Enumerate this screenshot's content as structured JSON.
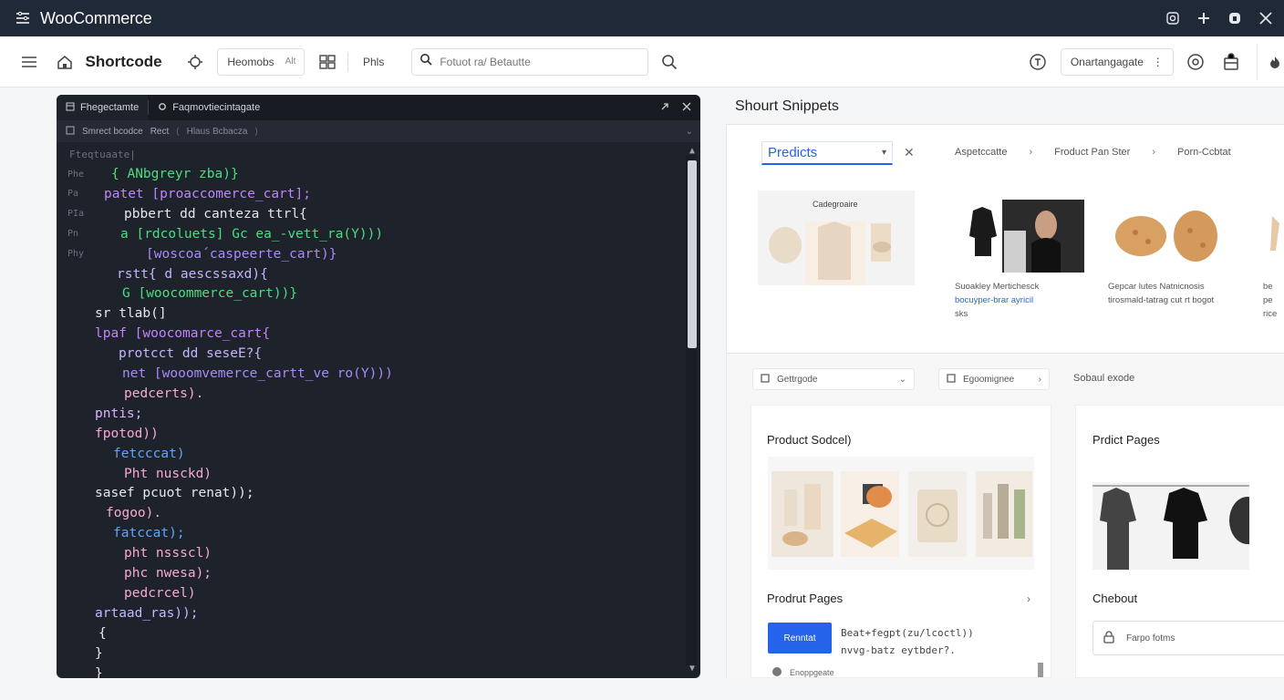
{
  "window": {
    "title": "WooCommerce",
    "controls": [
      "camera-icon",
      "plus-icon",
      "lock-icon",
      "close-icon"
    ]
  },
  "toolbar": {
    "title": "Shortcode",
    "pill1": {
      "label": "Heomobs",
      "kbd": "Alt"
    },
    "pill2_label": "Phls",
    "search_placeholder": "Fotuot ra/ Betautte",
    "dropdown_label": "Onartangagate",
    "dropdown_kbd": "⋮"
  },
  "editor": {
    "tabs": [
      {
        "label": "Fhegectamte",
        "icon": "window-icon"
      },
      {
        "label": "Faqmovtiecintagate",
        "icon": "gear-icon"
      }
    ],
    "sub": [
      "Smrect bcodce",
      "Rect",
      "(",
      "Hlaus Bcbacza",
      ")"
    ],
    "first_comment": "Fteqtuaate|",
    "lines": [
      {
        "n": "Phe",
        "text": "{ ANbgreyr zba)}",
        "color": "#4ade80",
        "indent": 60
      },
      {
        "n": "Pa",
        "text": "patet [proaccomerce_cart];",
        "color": "#c084fc",
        "indent": 52
      },
      {
        "n": "PIa",
        "text": "pbbert dd canteza ttrl{",
        "color": "#e5e7eb",
        "indent": 74
      },
      {
        "n": "Pn",
        "text": "a [rdcoluets] Gc ea_-vett_ra(Y)))",
        "color": "#4ade80",
        "indent": 70
      },
      {
        "n": "Phy",
        "text": "[woscoa´caspeerte_cart)}",
        "color": "#a78bfa",
        "indent": 98
      },
      {
        "n": "",
        "text": "rstt{ d aescssaxd){",
        "color": "#c4b5fd",
        "indent": 66
      },
      {
        "n": "",
        "text": "G [woocommerce_cart))}",
        "color": "#4ade80",
        "indent": 72
      },
      {
        "n": "",
        "text": "sr tlab(]",
        "color": "#e5e7eb",
        "indent": 42
      },
      {
        "n": "",
        "text": "lpaf [woocomarce_cart{",
        "color": "#c084fc",
        "indent": 42
      },
      {
        "n": "",
        "text": "protcct dd seseE?{",
        "color": "#c4b5fd",
        "indent": 68
      },
      {
        "n": "",
        "text": "net [wooomvemerce_cartt_ve ro(Y)))",
        "color": "#a78bfa",
        "indent": 72
      },
      {
        "n": "",
        "text": "pedcerts).",
        "color": "#f9a8d4",
        "indent": 74
      },
      {
        "n": "",
        "text": "pntis;",
        "color": "#d8b4fe",
        "indent": 42
      },
      {
        "n": "",
        "text": "fpotod))",
        "color": "#f9a8d4",
        "indent": 42
      },
      {
        "n": "",
        "text": "fetcccat)",
        "color": "#60a5fa",
        "indent": 62
      },
      {
        "n": "",
        "text": "Pht nusckd)",
        "color": "#f9a8d4",
        "indent": 74
      },
      {
        "n": "",
        "text": "sasef pcuot renat));",
        "color": "#e5e7eb",
        "indent": 42
      },
      {
        "n": "",
        "text": "fogoo).",
        "color": "#f9a8d4",
        "indent": 54
      },
      {
        "n": "",
        "text": "fatccat);",
        "color": "#60a5fa",
        "indent": 62
      },
      {
        "n": "",
        "text": "pht nssscl)",
        "color": "#f9a8d4",
        "indent": 74
      },
      {
        "n": "",
        "text": "phc nwesa);",
        "color": "#f9a8d4",
        "indent": 74
      },
      {
        "n": "",
        "text": "pedcrcel)",
        "color": "#f9a8d4",
        "indent": 74
      },
      {
        "n": "",
        "text": "artaad_ras));",
        "color": "#c4b5fd",
        "indent": 42
      },
      {
        "n": "",
        "text": "{",
        "color": "#e5e7eb",
        "indent": 46
      },
      {
        "n": "",
        "text": "}",
        "color": "#e5e7eb",
        "indent": 42
      },
      {
        "n": "",
        "text": "}",
        "color": "#e5e7eb",
        "indent": 42
      }
    ]
  },
  "snippets": {
    "title": "Shourt Snippets",
    "select_value": "Predicts",
    "crumbs": [
      "Aspetccatte",
      "Froduct Pan Ster",
      "Porn-Ccbtat"
    ],
    "thumb1_label": "Cadegroaire",
    "thumb2_caption": [
      "Suoakley Mertichesck",
      "bocuyper-brar ayricil",
      "sks"
    ],
    "thumb3_caption": [
      "Gepcar lutes Natnicnosis",
      "tirosmald-tatrag cut rt bogot"
    ],
    "thumb4_caption": [
      "be pe",
      "rice"
    ],
    "dd1": "Gettrgode",
    "dd2": "Egoomignee",
    "plain": "Sobaul exode",
    "card_left_title": "Product Sodcel)",
    "card_left_sub": "Prodrut Pages",
    "btn_label": "Renntat",
    "mini_code": [
      "Beat+fegpt(zu/lcoctl))",
      "nvvg-batz eytbder?."
    ],
    "footer_left": "Enoppgeate",
    "card_right_title": "Prdict Pages",
    "card_right_sub": "Chebout",
    "input_label": "Farpo fotms"
  }
}
